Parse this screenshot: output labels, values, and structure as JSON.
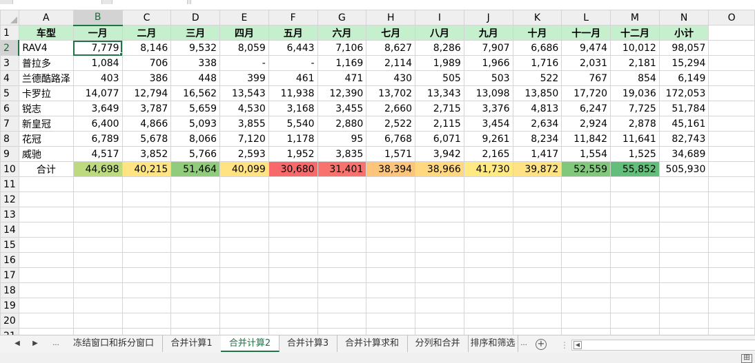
{
  "columns": [
    "A",
    "B",
    "C",
    "D",
    "E",
    "F",
    "G",
    "H",
    "I",
    "J",
    "K",
    "L",
    "M",
    "N",
    "O"
  ],
  "header_row": [
    "车型",
    "一月",
    "二月",
    "三月",
    "四月",
    "五月",
    "六月",
    "七月",
    "八月",
    "九月",
    "十月",
    "十一月",
    "十二月",
    "小计"
  ],
  "data_rows": [
    {
      "name": "RAV4",
      "values": [
        "7,779",
        "8,146",
        "9,532",
        "8,059",
        "6,443",
        "7,106",
        "8,627",
        "8,286",
        "7,907",
        "6,686",
        "9,474",
        "10,012",
        "98,057"
      ]
    },
    {
      "name": "普拉多",
      "values": [
        "1,084",
        "706",
        "338",
        "-",
        "-",
        "1,169",
        "2,114",
        "1,989",
        "1,966",
        "1,716",
        "2,031",
        "2,181",
        "15,294"
      ]
    },
    {
      "name": "兰德酷路泽",
      "values": [
        "403",
        "386",
        "448",
        "399",
        "461",
        "471",
        "430",
        "505",
        "503",
        "522",
        "767",
        "854",
        "6,149"
      ]
    },
    {
      "name": "卡罗拉",
      "values": [
        "14,077",
        "12,794",
        "16,562",
        "13,543",
        "11,938",
        "12,390",
        "13,702",
        "13,343",
        "13,098",
        "13,850",
        "17,720",
        "19,036",
        "172,053"
      ]
    },
    {
      "name": "锐志",
      "values": [
        "3,649",
        "3,787",
        "5,659",
        "4,530",
        "3,168",
        "3,455",
        "2,660",
        "2,715",
        "3,376",
        "4,813",
        "6,247",
        "7,725",
        "51,784"
      ]
    },
    {
      "name": "新皇冠",
      "values": [
        "6,400",
        "4,866",
        "5,093",
        "3,855",
        "5,540",
        "2,880",
        "2,522",
        "2,115",
        "3,454",
        "2,634",
        "2,924",
        "2,878",
        "45,161"
      ]
    },
    {
      "name": "花冠",
      "values": [
        "6,789",
        "5,678",
        "8,066",
        "7,120",
        "1,178",
        "95",
        "6,768",
        "6,071",
        "9,261",
        "8,234",
        "11,842",
        "11,641",
        "82,743"
      ]
    },
    {
      "name": "威驰",
      "values": [
        "4,517",
        "3,852",
        "5,766",
        "2,593",
        "1,952",
        "3,835",
        "1,571",
        "3,942",
        "2,165",
        "1,417",
        "1,554",
        "1,525",
        "34,689"
      ]
    }
  ],
  "total_row": {
    "label": "合计",
    "values": [
      "44,698",
      "40,215",
      "51,464",
      "40,099",
      "30,680",
      "31,401",
      "38,394",
      "38,966",
      "41,730",
      "39,872",
      "52,559",
      "55,852",
      "505,930"
    ],
    "colors": [
      "#bddb7e",
      "#ffe483",
      "#90cc7c",
      "#ffe383",
      "#f8696b",
      "#f8736e",
      "#fdc47c",
      "#ffd880",
      "#ffe983",
      "#fee283",
      "#81c77c",
      "#63be7b",
      "#ffffff"
    ]
  },
  "header_fill": "#c6efce",
  "accent_color": "#217346",
  "active_cell": {
    "row": 2,
    "col": "B"
  },
  "row_count": 22,
  "sheet_tabs": [
    "冻结窗口和拆分窗口",
    "合并计算1",
    "合并计算2",
    "合并计算3",
    "合并计算求和",
    "分列和合并",
    "排序和筛选"
  ],
  "active_sheet": "合并计算2",
  "more_tabs": "...",
  "more_tabs_right": "...",
  "add_sheet": "+",
  "nav_prev": "◀",
  "nav_next": "▶",
  "scroll_left": "◀",
  "view_icon": "田",
  "separator": "⋮"
}
